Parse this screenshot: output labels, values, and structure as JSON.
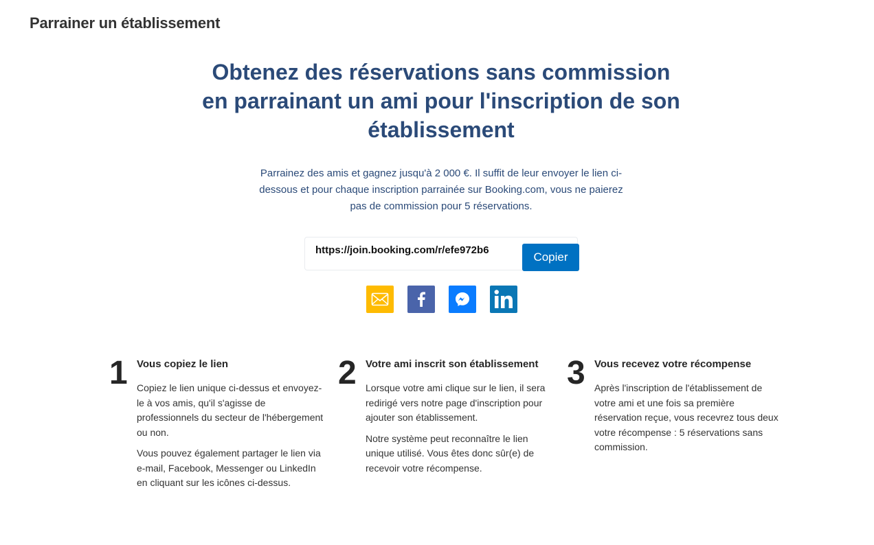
{
  "page": {
    "title": "Parrainer un établissement"
  },
  "hero": {
    "title": "Obtenez des réservations sans commission en parrainant un ami pour l'inscription de son établissement",
    "subtitle": "Parrainez des amis et gagnez jusqu'à 2 000 €. Il suffit de leur envoyer le lien ci-dessous et pour chaque inscription parrainée sur Booking.com, vous ne paierez pas de commission pour 5 réservations."
  },
  "referral": {
    "link": "https://join.booking.com/r/efe972b6",
    "copy_label": "Copier"
  },
  "share": {
    "buttons": [
      {
        "icon": "envelope-icon",
        "color": "#febb02"
      },
      {
        "icon": "facebook-icon",
        "color": "#4a64aa"
      },
      {
        "icon": "messenger-icon",
        "color": "#0a7cff"
      },
      {
        "icon": "linkedin-icon",
        "color": "#0a77b5"
      }
    ]
  },
  "steps": [
    {
      "number": "1",
      "title": "Vous copiez le lien",
      "paragraphs": [
        "Copiez le lien unique ci-dessus et envoyez-le à vos amis, qu'il s'agisse de professionnels du secteur de l'hébergement ou non.",
        "Vous pouvez également partager le lien via e-mail, Facebook, Messenger ou LinkedIn en cliquant sur les icônes ci-dessus."
      ]
    },
    {
      "number": "2",
      "title": "Votre ami inscrit son établissement",
      "paragraphs": [
        "Lorsque votre ami clique sur le lien, il sera redirigé vers notre page d'inscription pour ajouter son établissement.",
        "Notre système peut reconnaître le lien unique utilisé. Vous êtes donc sûr(e) de recevoir votre récompense."
      ]
    },
    {
      "number": "3",
      "title": "Vous recevez votre récompense",
      "paragraphs": [
        "Après l'inscription de l'établissement de votre ami et une fois sa première réservation reçue, vous recevrez tous deux votre récompense : 5 réservations sans commission."
      ]
    }
  ]
}
